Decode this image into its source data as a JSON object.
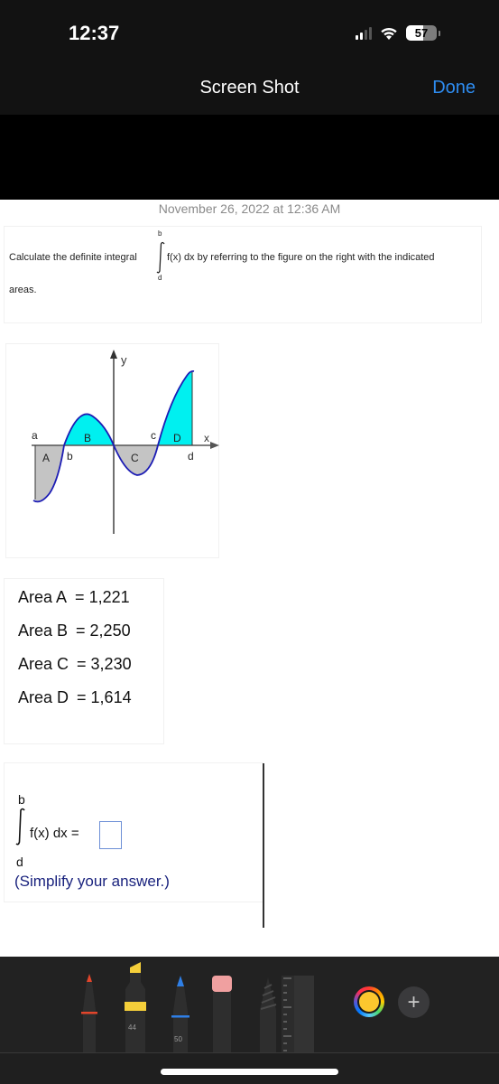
{
  "status_bar": {
    "time": "12:37",
    "battery_percent": "57",
    "signal_bars_active": 2,
    "signal_bars_total": 4
  },
  "nav": {
    "title": "Screen Shot",
    "done_label": "Done",
    "accent_color": "#2e8cf0"
  },
  "capture_date": "November 26, 2022 at 12:36 AM",
  "question": {
    "prefix": "Calculate the definite integral",
    "integral_upper": "b",
    "integral_lower": "d",
    "suffix": "f(x) dx by referring to the figure on the right with the indicated",
    "continuation": "areas."
  },
  "figure": {
    "axis_x_label": "x",
    "axis_y_label": "y",
    "point_labels": {
      "a": "a",
      "b": "b",
      "c": "c",
      "d": "d"
    },
    "region_labels": {
      "A": "A",
      "B": "B",
      "C": "C",
      "D": "D"
    },
    "colors": {
      "positive": "#00f0f0",
      "negative": "#c0c0c0",
      "curve": "#1c1cb4"
    }
  },
  "areas": [
    {
      "label": "Area A",
      "value": "1,221"
    },
    {
      "label": "Area B",
      "value": "2,250"
    },
    {
      "label": "Area C",
      "value": "3,230"
    },
    {
      "label": "Area D",
      "value": "1,614"
    }
  ],
  "answer": {
    "upper": "b",
    "lower": "d",
    "expression": "f(x) dx =",
    "input_value": "",
    "hint": "(Simplify your answer.)"
  },
  "markup_tools": [
    {
      "name": "pen",
      "color": "#e2452b",
      "width_label": ""
    },
    {
      "name": "highlighter",
      "color": "#f5cf3a",
      "width_label": "44"
    },
    {
      "name": "pencil",
      "color": "#2f7fe6",
      "width_label": "50"
    },
    {
      "name": "eraser",
      "color": "#f0a0a0",
      "width_label": ""
    },
    {
      "name": "lasso",
      "color": "#555555",
      "width_label": ""
    },
    {
      "name": "ruler",
      "color": "#3a3a3a",
      "width_label": ""
    }
  ],
  "color_picker": {
    "selected_color": "#fcc72e"
  },
  "add_label": "+"
}
